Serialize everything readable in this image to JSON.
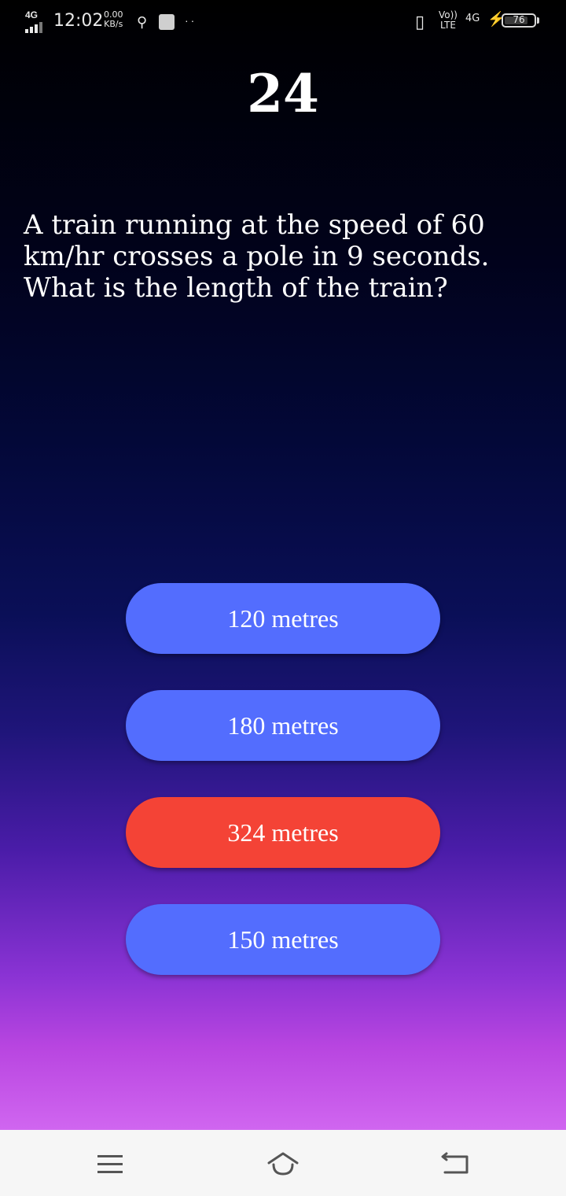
{
  "status_bar": {
    "network_type": "4G",
    "time": "12:02",
    "speed_value": "0.00",
    "speed_unit": "KB/s",
    "volte_line1": "Vo))",
    "volte_line2": "LTE",
    "network_right": "4G",
    "battery_level": "76",
    "icons": [
      "signal-icon",
      "usb-icon",
      "app-notification-icon",
      "more-dots-icon",
      "vibrate-icon",
      "charging-icon",
      "battery-icon"
    ]
  },
  "quiz": {
    "question_number": "24",
    "question_text": "A train running at the speed of 60 km/hr crosses a pole in 9 seconds. What is the length of the train?",
    "answers": [
      {
        "label": "120 metres",
        "state": "default"
      },
      {
        "label": "180 metres",
        "state": "default"
      },
      {
        "label": "324 metres",
        "state": "selected"
      },
      {
        "label": "150 metres",
        "state": "default"
      }
    ]
  },
  "colors": {
    "answer_default": "#536dfe",
    "answer_selected": "#f44336",
    "background_top": "#000000",
    "background_bottom": "#d066f0",
    "navbar": "#f6f6f6"
  },
  "nav_bar": {
    "icons": [
      "menu-icon",
      "home-icon",
      "back-icon"
    ]
  }
}
